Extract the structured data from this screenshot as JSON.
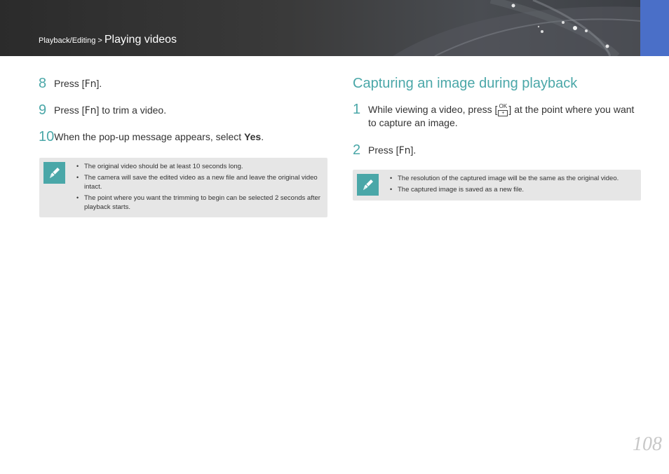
{
  "header": {
    "breadcrumb_section": "Playback/Editing",
    "breadcrumb_separator": " > ",
    "breadcrumb_current": "Playing videos"
  },
  "left_steps": [
    {
      "num": "8",
      "pre": "Press [",
      "key": "Fn",
      "post": "]."
    },
    {
      "num": "9",
      "pre": "Press [",
      "key": "Fn",
      "post": "] to trim a video."
    },
    {
      "num": "10",
      "pre": "When the pop-up message appears, select ",
      "bold": "Yes",
      "post": "."
    }
  ],
  "left_note": {
    "icon": "pencil-note-icon",
    "items": [
      "The original video should be at least 10 seconds long.",
      "The camera will save the edited video as a new file and leave the original video intact.",
      "The point where you want the trimming to begin can be selected 2 seconds after playback starts."
    ]
  },
  "right_section": {
    "title": "Capturing an image during playback",
    "steps": [
      {
        "num": "1",
        "pre": "While viewing a video, press [",
        "key_top": "OK",
        "key_bottom": "+",
        "post": "] at the point where you want",
        "line2": "to capture an image."
      },
      {
        "num": "2",
        "pre": "Press [",
        "key": "Fn",
        "post": "]."
      }
    ]
  },
  "right_note": {
    "icon": "pencil-note-icon",
    "items": [
      "The resolution of the captured image will be the same as the original video.",
      "The captured image is saved as a new file."
    ]
  },
  "page_number": "108",
  "colors": {
    "accent": "#4aa7a8",
    "header_tab": "#4a6fc8",
    "note_bg": "#e6e6e6"
  }
}
